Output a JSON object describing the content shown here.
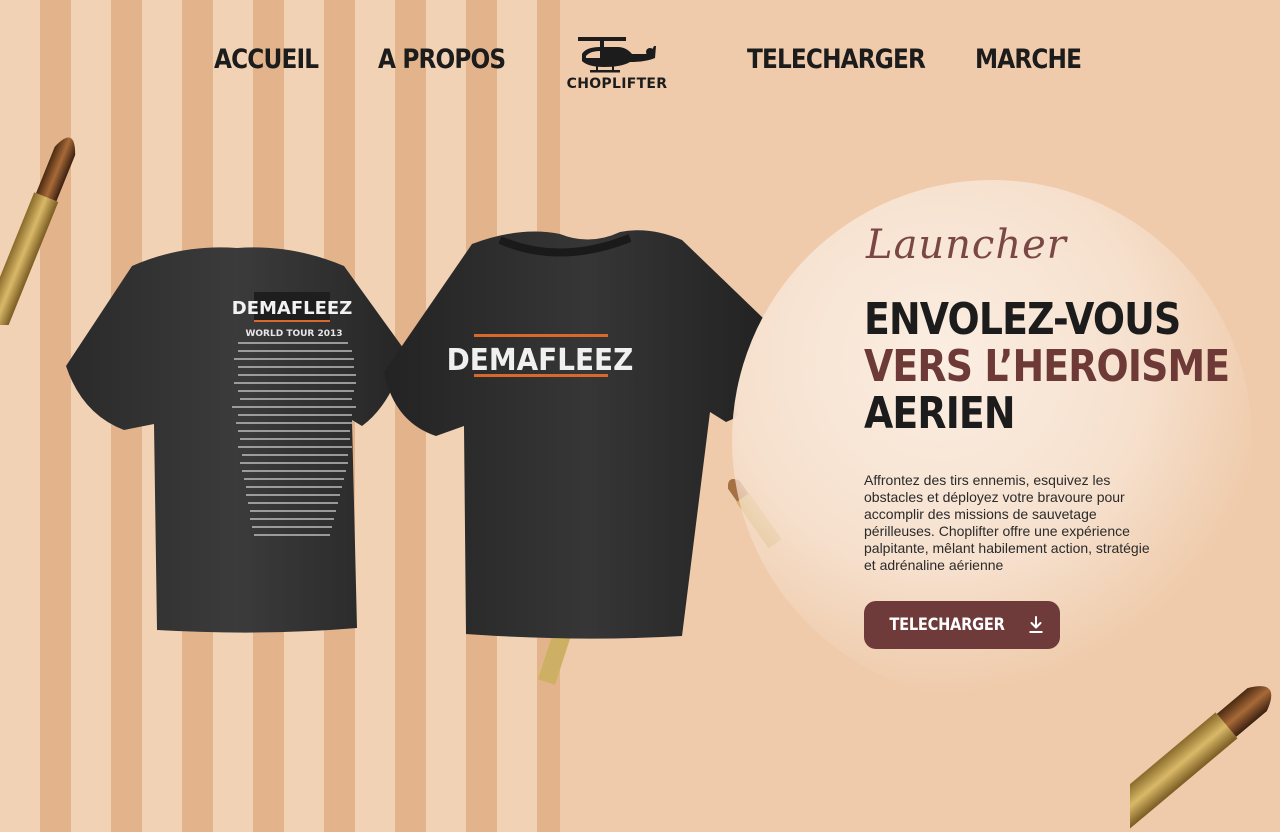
{
  "nav": {
    "items": [
      {
        "label": "ACCUEIL"
      },
      {
        "label": "A PROPOS"
      },
      {
        "label": "TELECHARGER"
      },
      {
        "label": "MARCHE"
      }
    ],
    "logo_text": "CHOPLIFTER"
  },
  "hero": {
    "script_title": "Launcher",
    "headline_line1": "ENVOLEZ-VOUS",
    "headline_line2": "VERS L’HEROISME",
    "headline_line3": "AERIEN",
    "description": "Affrontez des tirs ennemis, esquivez les obstacles et déployez votre bravoure pour accomplir des missions de sauvetage périlleuses. Choplifter offre une expérience palpitante, mêlant habilement action, stratégie et adrénaline aérienne",
    "button_label": "TELECHARGER"
  },
  "shirts": {
    "back_brand": "DEMAFLEEZ",
    "back_subtitle": "WORLD TOUR 2013",
    "front_brand": "DEMAFLEEZ"
  },
  "colors": {
    "background": "#efcbab",
    "accent": "#6e3a3a",
    "text_dark": "#1c1c1c"
  }
}
